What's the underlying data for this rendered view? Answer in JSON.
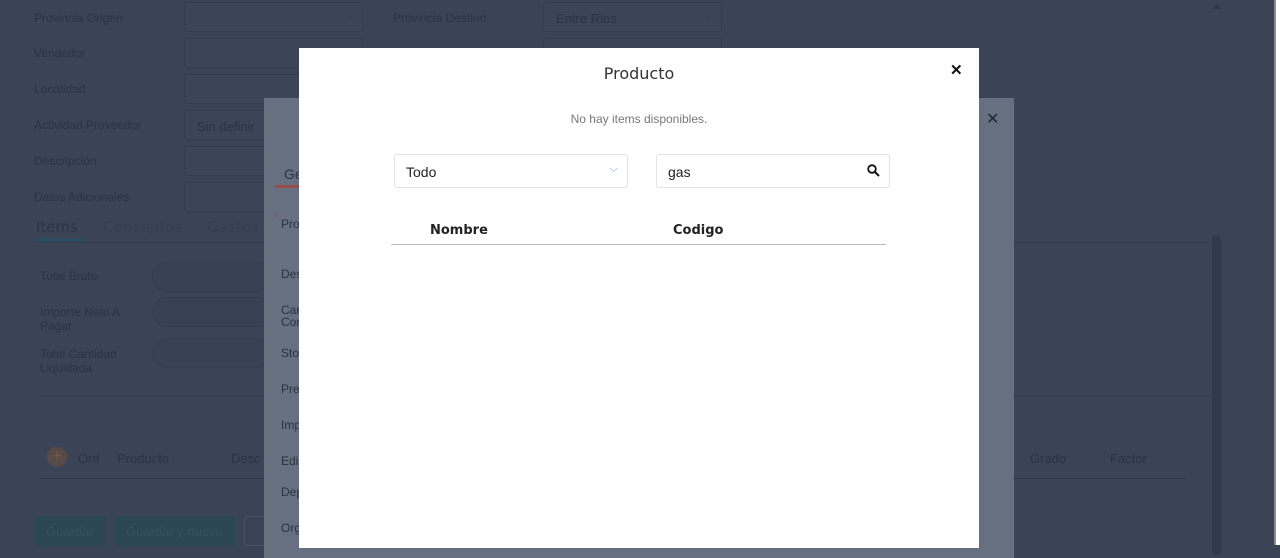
{
  "background_form": {
    "fields": [
      {
        "label": "Provincia Origen",
        "value": ""
      },
      {
        "label": "Vendedor",
        "value": ""
      },
      {
        "label": "Localidad",
        "value": ""
      },
      {
        "label": "Actividad Proveedor",
        "value": "Sin definir"
      },
      {
        "label": "Descripción",
        "value": ""
      },
      {
        "label": "Datos Adicionales",
        "value": ""
      }
    ],
    "provincia_destino_label": "Provincia Destino",
    "provincia_destino_value": "Entre Rios",
    "tabs": [
      "Items",
      "Conceptos",
      "Gastos"
    ],
    "totals": [
      "Total Bruto",
      "Importe Neto A Pagar",
      "Total Cantidad Liquidada"
    ],
    "columns": [
      "Ord",
      "Producto",
      "Desc",
      "Grado",
      "Factor"
    ],
    "buttons": [
      "Guardar",
      "Guardar y nuevo"
    ]
  },
  "middle_modal": {
    "tab": "Ge",
    "labels": [
      "Pro",
      "Des",
      "Car\nCon",
      "Sto",
      "Pre",
      "Imp",
      "Edi",
      "Dep",
      "Org"
    ]
  },
  "product_modal": {
    "title": "Producto",
    "empty_message": "No hay items disponibles.",
    "filter_value": "Todo",
    "search_value": "gas",
    "columns": [
      "Nombre",
      "Codigo"
    ]
  }
}
